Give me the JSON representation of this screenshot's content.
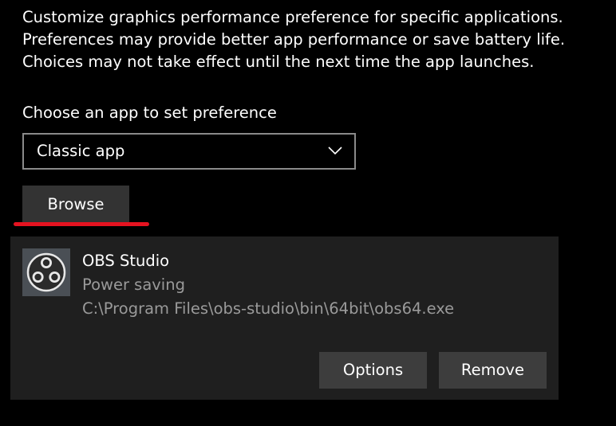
{
  "description": {
    "lines": [
      "Customize graphics performance preference for specific applications.",
      "Preferences may provide better app performance or save battery life.",
      "Choices may not take effect until the next time the app launches."
    ]
  },
  "app_picker": {
    "label": "Choose an app to set preference",
    "selected": "Classic app",
    "dropdown_icon": "chevron-down-icon",
    "browse_label": "Browse"
  },
  "app_entry": {
    "icon": "obs-studio-icon",
    "name": "OBS Studio",
    "preference": "Power saving",
    "path": "C:\\Program Files\\obs-studio\\bin\\64bit\\obs64.exe",
    "options_label": "Options",
    "remove_label": "Remove"
  },
  "colors": {
    "background": "#000000",
    "card_background": "#1f1f1f",
    "button_background": "#333333",
    "secondary_text": "#9a9a9a",
    "annotation_red": "#e51320"
  }
}
